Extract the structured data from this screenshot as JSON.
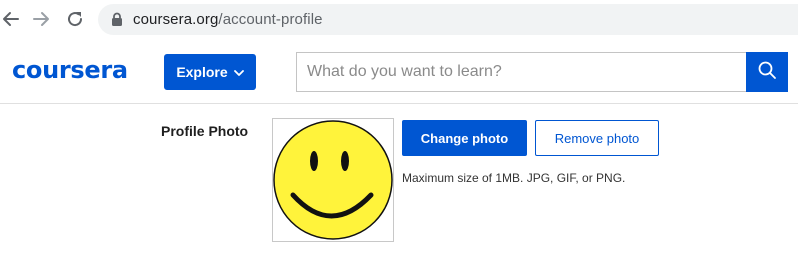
{
  "browser": {
    "url_domain": "coursera.org",
    "url_path": "/account-profile",
    "icons": [
      "back-arrow-icon",
      "forward-arrow-icon",
      "reload-icon",
      "lock-icon"
    ]
  },
  "header": {
    "logo_text": "coursera",
    "explore_label": "Explore",
    "search_placeholder": "What do you want to learn?",
    "brand_color": "#0056d2"
  },
  "profile": {
    "label": "Profile Photo",
    "change_photo_label": "Change photo",
    "remove_photo_label": "Remove photo",
    "size_note": "Maximum size of 1MB. JPG, GIF, or PNG.",
    "photo_icon": "smiley-face-icon"
  }
}
